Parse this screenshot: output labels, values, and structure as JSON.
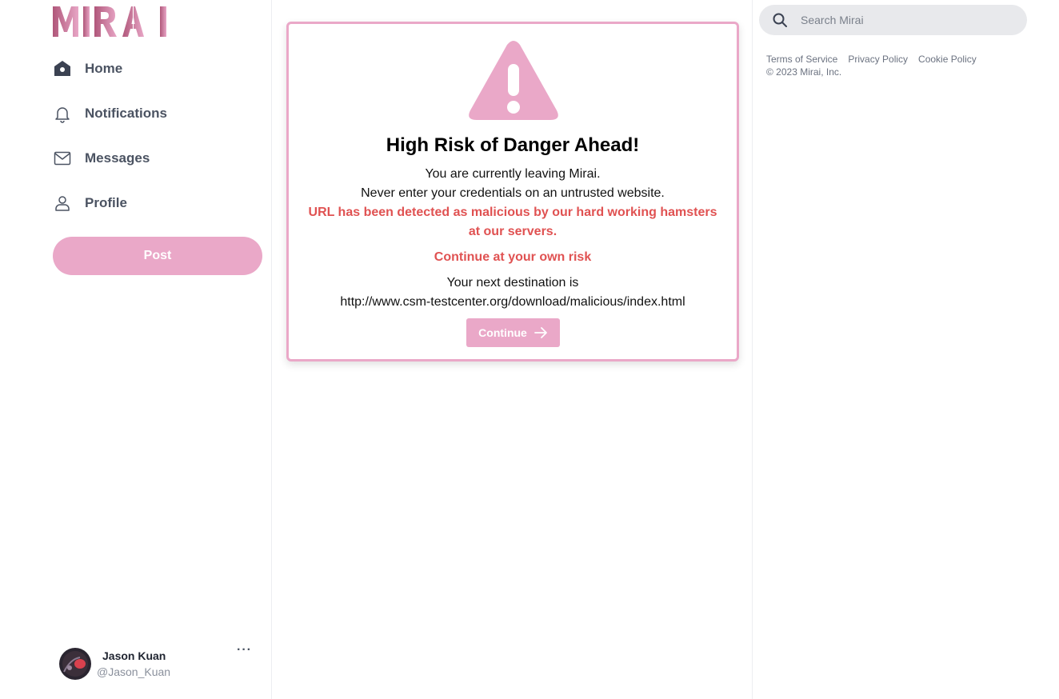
{
  "brand": {
    "name": "MIRAI",
    "accent": "#eaa8c8",
    "danger": "#e05252"
  },
  "sidebar": {
    "items": [
      {
        "label": "Home",
        "icon": "home-icon"
      },
      {
        "label": "Notifications",
        "icon": "bell-icon"
      },
      {
        "label": "Messages",
        "icon": "mail-icon"
      },
      {
        "label": "Profile",
        "icon": "user-icon"
      }
    ],
    "post_label": "Post"
  },
  "user": {
    "name": "Jason Kuan",
    "handle": "@Jason_Kuan",
    "more": "···"
  },
  "warning": {
    "icon": "warning-triangle-icon",
    "title": "High Risk of Danger Ahead!",
    "line1": "You are currently leaving Mirai.",
    "line2": "Never enter your credentials on an untrusted website.",
    "malicious_line1": "URL has been detected as malicious by our hard working hamsters",
    "malicious_line2": "at our servers.",
    "risk": "Continue at your own risk",
    "destination_label": "Your next destination is",
    "destination_url": "http://www.csm-testcenter.org/download/malicious/index.html",
    "continue_label": "Continue"
  },
  "search": {
    "placeholder": "Search Mirai",
    "value": ""
  },
  "footer": {
    "links": [
      "Terms of Service",
      "Privacy Policy",
      "Cookie Policy"
    ],
    "copyright": "© 2023 Mirai, Inc."
  }
}
